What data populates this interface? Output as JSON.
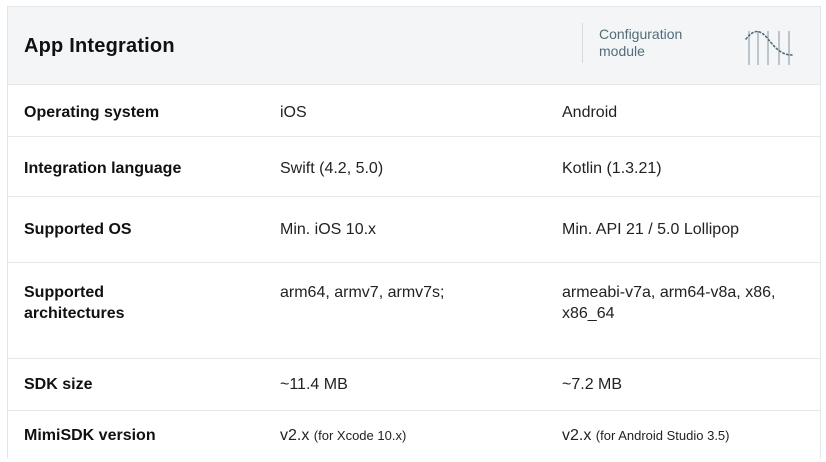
{
  "header": {
    "title": "App Integration",
    "module_label": "Configuration module",
    "logo_icon": "waveform-logo-icon"
  },
  "rows": [
    {
      "label": "Operating system",
      "ios": "iOS",
      "android": "Android"
    },
    {
      "label": "Integration language",
      "ios": "Swift (4.2, 5.0)",
      "android": "Kotlin (1.3.21)"
    },
    {
      "label": "Supported OS",
      "ios": "Min. iOS 10.x",
      "android": "Min. API 21 / 5.0 Lollipop"
    },
    {
      "label": "Supported architectures",
      "ios": "arm64, armv7, armv7s;",
      "android": "armeabi-v7a, arm64-v8a, x86, x86_64"
    },
    {
      "label": "SDK size",
      "ios": "~11.4 MB",
      "android": "~7.2 MB"
    },
    {
      "label": "MimiSDK version",
      "ios": "v2.x",
      "ios_note": "(for Xcode 10.x)",
      "android": "v2.x",
      "android_note": "(for Android Studio 3.5)"
    }
  ],
  "colors": {
    "header_bg": "#f4f5f7",
    "accent_text": "#4f6d7a",
    "divider": "#e6e8eb"
  }
}
